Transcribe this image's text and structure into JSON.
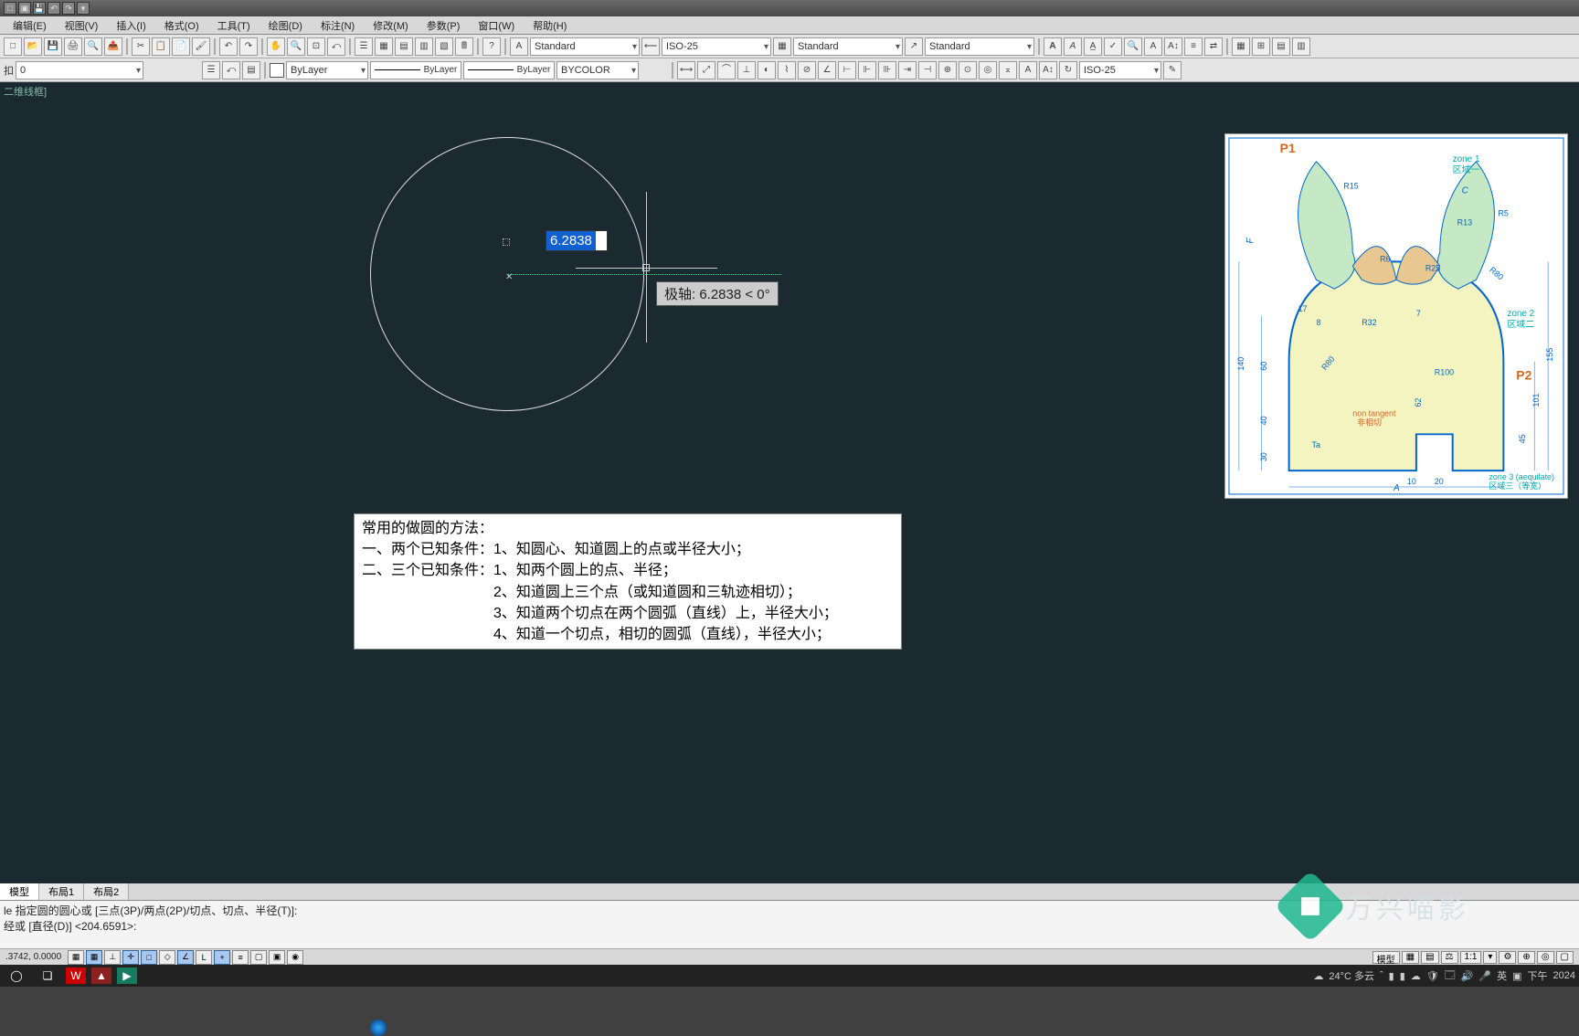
{
  "menu": {
    "items": [
      "编辑(E)",
      "视图(V)",
      "插入(I)",
      "格式(O)",
      "工具(T)",
      "绘图(D)",
      "标注(N)",
      "修改(M)",
      "参数(P)",
      "窗口(W)",
      "帮助(H)"
    ]
  },
  "toolbar1": {
    "text_style": "Standard",
    "dim_style": "ISO-25",
    "table_style": "Standard",
    "mleader_style": "Standard"
  },
  "toolbar2": {
    "layer": "0",
    "layer_combo_label": "ByLayer",
    "lineweight": "ByLayer",
    "linetype": "ByLayer",
    "color": "BYCOLOR",
    "dim_style2": "ISO-25"
  },
  "view": {
    "label": "二维线框]"
  },
  "dynamic": {
    "value": "6.2838",
    "tooltip": "极轴: 6.2838 < 0°"
  },
  "notes": {
    "title": "常用的做圆的方法：",
    "l1": "一、两个已知条件：1、知圆心、知道圆上的点或半径大小；",
    "l2": "二、三个已知条件：1、知两个圆上的点、半径；",
    "l3": "　　　　　　　　　2、知道圆上三个点（或知道圆和三轨迹相切）；",
    "l4": "　　　　　　　　　3、知道两个切点在两个圆弧（直线）上，半径大小；",
    "l5": "　　　　　　　　　4、知道一个切点，相切的圆弧（直线），半径大小；"
  },
  "tabs": {
    "items": [
      "模型",
      "布局1",
      "布局2"
    ]
  },
  "cmd": {
    "hist1": "le 指定圆的圆心或 [三点(3P)/两点(2P)/切点、切点、半径(T)]:",
    "hist2": "经或 [直径(D)] <204.6591>:",
    "hint": ""
  },
  "status": {
    "coords": ".3742, 0.0000",
    "scale": "1:1",
    "model_btn": "模型"
  },
  "taskbar": {
    "weather": "24°C 多云",
    "ime": "英",
    "time": "下午",
    "date": "2024"
  },
  "watermark": {
    "text": "万兴喵影"
  },
  "ref": {
    "p1": "P1",
    "p2": "P2",
    "zone1a": "zone 1",
    "zone1b": "区域一",
    "zone2a": "zone 2",
    "zone2b": "区域二",
    "zone3a": "zone 3 (aequilate)",
    "zone3b": "区域三（等宽）",
    "nt1": "non tangent",
    "nt2": "非相切",
    "d140": "140",
    "d60": "60",
    "d40": "40",
    "d30": "30",
    "d155": "155",
    "d101": "101",
    "d45": "45",
    "d62": "62",
    "d10": "10",
    "d20": "20",
    "r80": "R80",
    "r32": "R32",
    "r100": "R100",
    "r25": "R25",
    "r13": "R13",
    "r5": "R5",
    "r15": "R15",
    "r6": "R6",
    "a17": "17",
    "a8": "8",
    "a7": "7",
    "dimA": "A",
    "dimC": "C",
    "dimF": "F",
    "r80b": "R80",
    "t0l": "Ta"
  }
}
